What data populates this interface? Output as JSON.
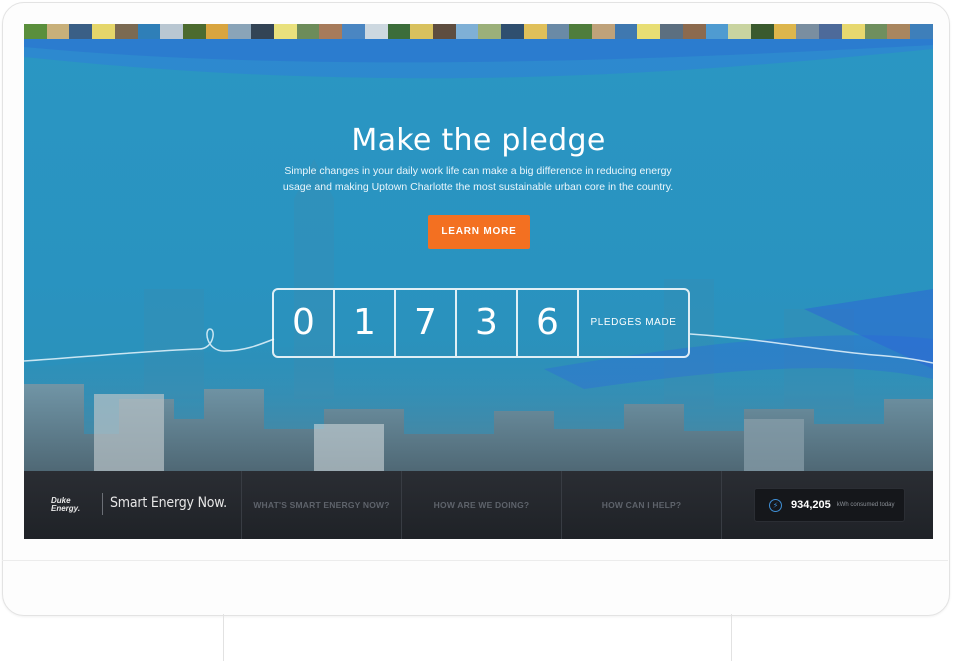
{
  "hero": {
    "title": "Make the pledge",
    "description": "Simple changes in your daily work life can make a big difference in reducing energy usage and making Uptown Charlotte the most sustainable urban core in the country.",
    "cta_label": "LEARN MORE"
  },
  "counter": {
    "digits": [
      "0",
      "1",
      "7",
      "3",
      "6"
    ],
    "label": "PLEDGES MADE"
  },
  "nav": {
    "logo_text_line1": "Duke",
    "logo_text_line2": "Energy.",
    "brand": "Smart Energy Now.",
    "items": [
      {
        "label": "WHAT'S SMART ENERGY NOW?"
      },
      {
        "label": "HOW ARE WE DOING?"
      },
      {
        "label": "HOW CAN I HELP?"
      }
    ],
    "stat": {
      "value": "934,205",
      "unit": "kWh consumed today",
      "icon": "bolt-icon"
    }
  },
  "colors": {
    "hero_blue": "#2a96c3",
    "cta_orange": "#f37021",
    "nav_dark": "#23262b"
  }
}
